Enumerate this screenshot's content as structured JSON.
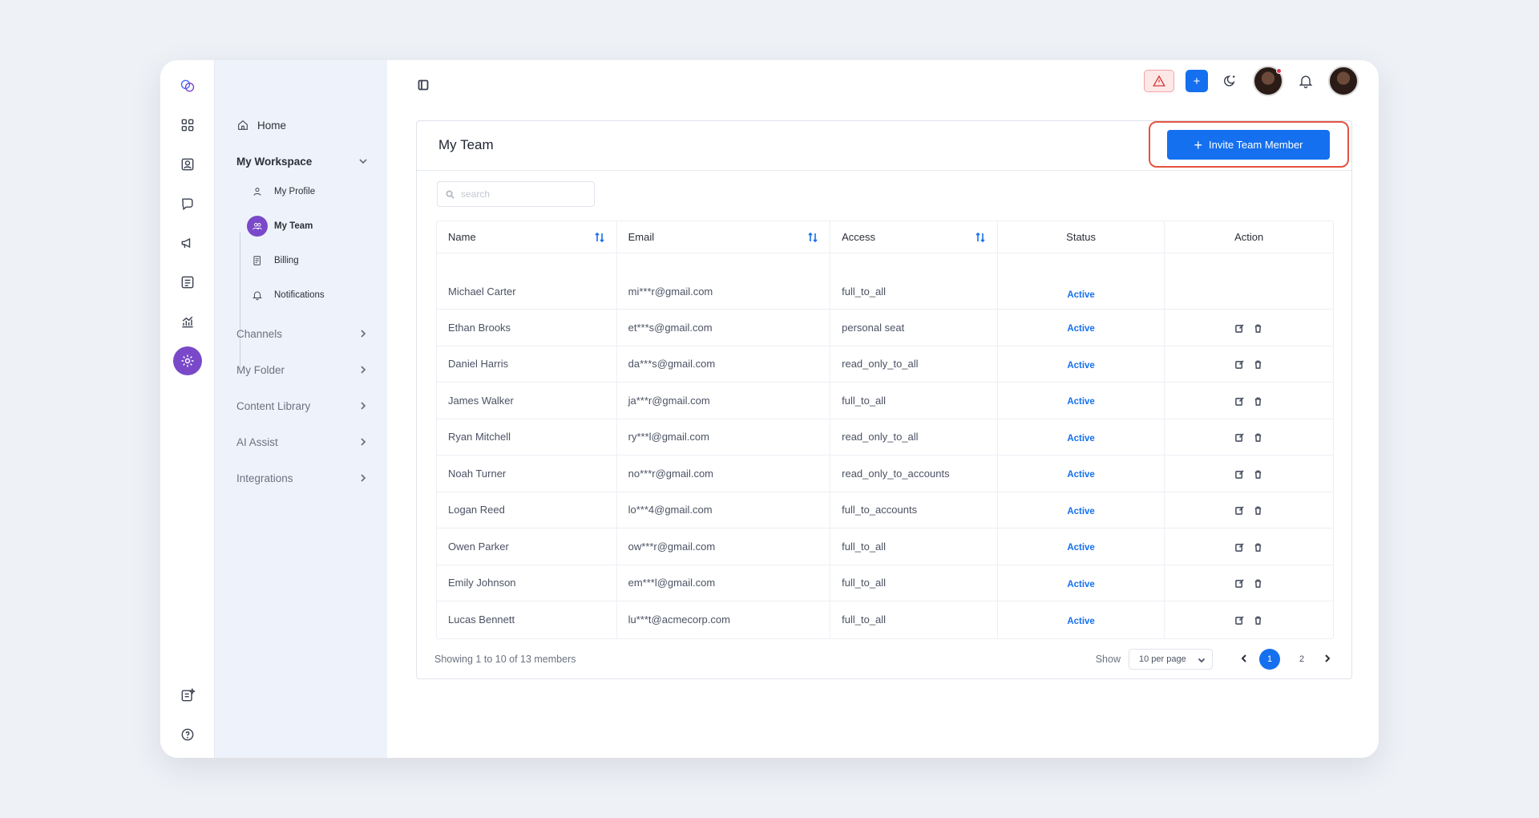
{
  "nav": {
    "home": "Home",
    "workspace": "My Workspace",
    "sub": [
      {
        "label": "My Profile",
        "icon": "user-icon",
        "active": false
      },
      {
        "label": "My Team",
        "icon": "team-icon",
        "active": true
      },
      {
        "label": "Billing",
        "icon": "billing-icon",
        "active": false
      },
      {
        "label": "Notifications",
        "icon": "bell-icon",
        "active": false
      }
    ],
    "sections": [
      "Channels",
      "My Folder",
      "Content Library",
      "AI Assist",
      "Integrations"
    ]
  },
  "card": {
    "title": "My Team",
    "invite_label": "Invite Team Member",
    "search_placeholder": "search"
  },
  "table": {
    "columns": [
      "Name",
      "Email",
      "Access",
      "Status",
      "Action"
    ],
    "rows": [
      {
        "name": "Michael Carter",
        "email": "mi***r@gmail.com",
        "access": "full_to_all",
        "status": "Active",
        "actions": false
      },
      {
        "name": "Ethan Brooks",
        "email": "et***s@gmail.com",
        "access": "personal seat",
        "status": "Active",
        "actions": true
      },
      {
        "name": "Daniel Harris",
        "email": "da***s@gmail.com",
        "access": "read_only_to_all",
        "status": "Active",
        "actions": true
      },
      {
        "name": "James Walker",
        "email": "ja***r@gmail.com",
        "access": "full_to_all",
        "status": "Active",
        "actions": true
      },
      {
        "name": "Ryan Mitchell",
        "email": "ry***l@gmail.com",
        "access": "read_only_to_all",
        "status": "Active",
        "actions": true
      },
      {
        "name": "Noah Turner",
        "email": "no***r@gmail.com",
        "access": "read_only_to_accounts",
        "status": "Active",
        "actions": true
      },
      {
        "name": "Logan Reed",
        "email": "lo***4@gmail.com",
        "access": "full_to_accounts",
        "status": "Active",
        "actions": true
      },
      {
        "name": "Owen Parker",
        "email": "ow***r@gmail.com",
        "access": "full_to_all",
        "status": "Active",
        "actions": true
      },
      {
        "name": "Emily Johnson",
        "email": "em***l@gmail.com",
        "access": "full_to_all",
        "status": "Active",
        "actions": true
      },
      {
        "name": "Lucas Bennett",
        "email": "lu***t@acmecorp.com",
        "access": "full_to_all",
        "status": "Active",
        "actions": true
      }
    ]
  },
  "footer": {
    "showing": "Showing 1 to 10 of 13 members",
    "show_label": "Show",
    "per_page": "10 per page",
    "pages": [
      "1",
      "2"
    ],
    "current_page": "1"
  },
  "colors": {
    "accent": "#1570ef",
    "purple": "#7a49c9",
    "highlight": "#e55340"
  }
}
